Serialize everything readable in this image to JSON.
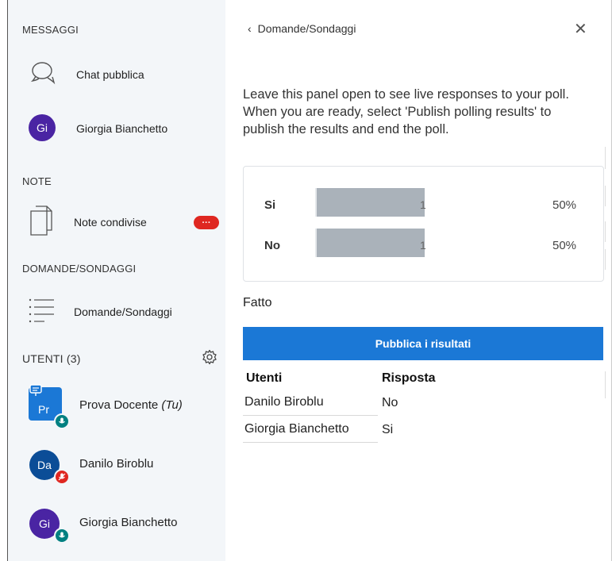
{
  "sidebar": {
    "messages_title": "MESSAGGI",
    "public_chat": "Chat pubblica",
    "private_chat": {
      "initials": "Gi",
      "name": "Giorgia Bianchetto",
      "color": "#4a24a3"
    },
    "notes_title": "NOTE",
    "shared_notes": "Note condivise",
    "notes_badge": "···",
    "polls_title": "DOMANDE/SONDAGGI",
    "polls_item": "Domande/Sondaggi",
    "users_title": "UTENTI (3)",
    "users": [
      {
        "initials": "Pr",
        "name": "Prova Docente",
        "you": "(Tu)",
        "color": "#1b78d6",
        "mic": "unmuted"
      },
      {
        "initials": "Da",
        "name": "Danilo Biroblu",
        "color": "#0b4d97",
        "mic": "muted"
      },
      {
        "initials": "Gi",
        "name": "Giorgia Bianchetto",
        "color": "#4a24a3",
        "mic": "unmuted"
      }
    ]
  },
  "panel": {
    "title": "Domande/Sondaggi",
    "description": "Leave this panel open to see live responses to your poll. When you are ready, select 'Publish polling results' to publish the results and end the poll.",
    "results": [
      {
        "label": "Si",
        "count": "1",
        "percent": "50%",
        "fraction": 0.5
      },
      {
        "label": "No",
        "count": "1",
        "percent": "50%",
        "fraction": 0.5
      }
    ],
    "status": "Fatto",
    "publish_label": "Pubblica i risultati",
    "table": {
      "headers": [
        "Utenti",
        "Risposta"
      ],
      "rows": [
        {
          "user": "Danilo Biroblu",
          "answer": "No"
        },
        {
          "user": "Giorgia Bianchetto",
          "answer": "Si"
        }
      ]
    }
  },
  "colors": {
    "accent": "#1b78d6",
    "mic_on": "#008081",
    "mic_off": "#df2721"
  }
}
